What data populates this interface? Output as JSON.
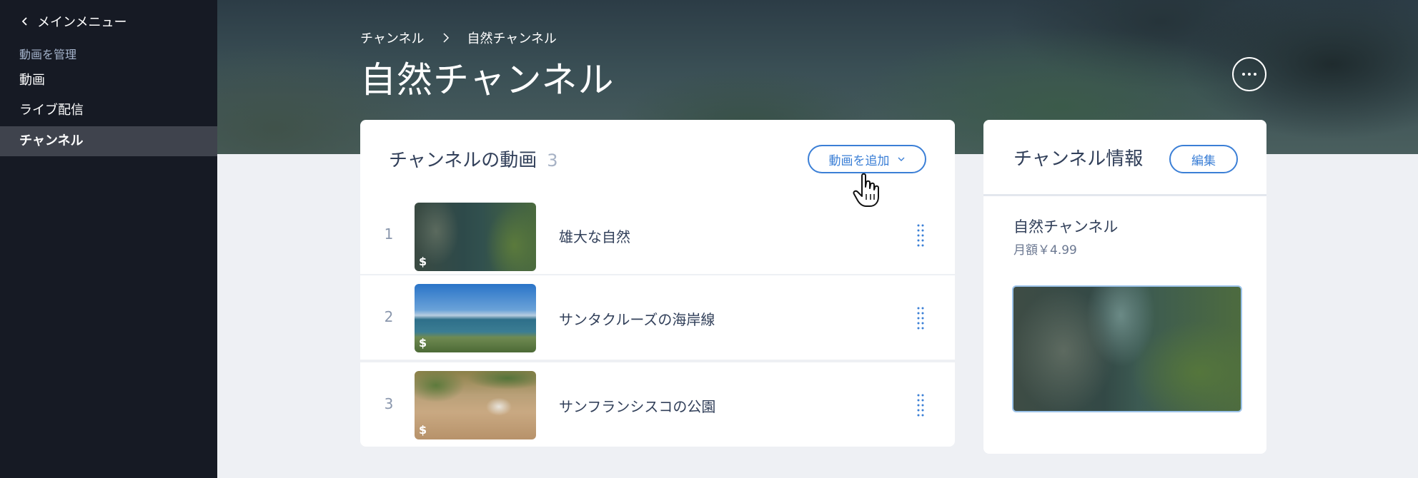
{
  "sidebar": {
    "back_label": "メインメニュー",
    "section_label": "動画を管理",
    "items": [
      {
        "label": "動画"
      },
      {
        "label": "ライブ配信"
      },
      {
        "label": "チャンネル"
      }
    ]
  },
  "header": {
    "breadcrumb": [
      "チャンネル",
      "自然チャンネル"
    ],
    "title": "自然チャンネル"
  },
  "videos": {
    "title": "チャンネルの動画",
    "count": "3",
    "add_button": "動画を追加",
    "items": [
      {
        "num": "1",
        "title": "雄大な自然",
        "badge": "$"
      },
      {
        "num": "2",
        "title": "サンタクルーズの海岸線",
        "badge": "$"
      },
      {
        "num": "3",
        "title": "サンフランシスコの公園",
        "badge": "$"
      }
    ]
  },
  "info": {
    "title": "チャンネル情報",
    "edit_button": "編集",
    "name": "自然チャンネル",
    "price": "月額￥4.99"
  },
  "colors": {
    "accent": "#3b7fd6",
    "sidebar_bg": "#161a24",
    "sidebar_active": "#3f434d",
    "page_bg": "#eef0f4"
  },
  "icons": [
    "chevron-left-icon",
    "chevron-right-icon",
    "more-icon",
    "chevron-down-icon",
    "drag-handle-icon",
    "hand-cursor-icon"
  ]
}
